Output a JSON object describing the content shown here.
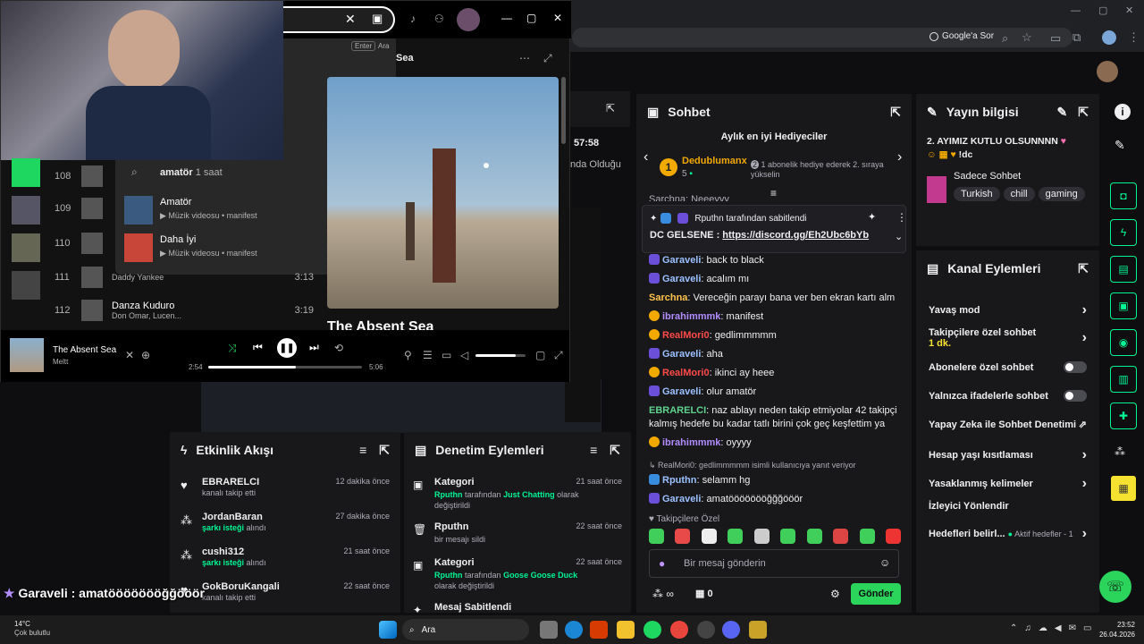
{
  "chrome": {
    "google_ask": "Google'a Sor"
  },
  "spotify": {
    "search_value": "amatör",
    "enter_hint": "Enter",
    "ara_hint": "Ara",
    "suggestion_query": "amatör",
    "suggestion_time": "1 saat",
    "results": [
      {
        "title": "Amatör",
        "meta": "Müzik videosu • manifest"
      },
      {
        "title": "Daha İyi",
        "meta": "Müzik videosu • manifest"
      }
    ],
    "album_title_header": "Sea",
    "album_title": "The Absent Sea",
    "tracks": [
      {
        "num": "108",
        "title": "",
        "artist": "",
        "duration": ""
      },
      {
        "num": "109",
        "title": "",
        "artist": "",
        "duration": ""
      },
      {
        "num": "110",
        "title": "",
        "artist": "",
        "duration": ""
      },
      {
        "num": "111",
        "title": "",
        "artist": "Daddy Yankee",
        "duration": "3:13"
      },
      {
        "num": "112",
        "title": "Danza Kuduro",
        "artist": "Don Omar, Lucen...",
        "duration": "3:19"
      }
    ],
    "now_playing_title": "The Absent Sea",
    "now_playing_artist": "Meltt",
    "elapsed": "2:54",
    "total": "5:06",
    "progress": 0.57,
    "volume": 0.8
  },
  "overlay_text": {
    "time": "57:58",
    "olduğu": "nda Olduğu",
    "garaveli": "Garaveli : amatöööööööğğööör"
  },
  "stream_info": {
    "title": "Yayın bilgisi",
    "stream_title": "2. AYIMIZ KUTLU OLSUNNNN",
    "stream_title2": "!dc",
    "category": "Sadece Sohbet",
    "tags": [
      "Turkish",
      "chill",
      "gaming"
    ]
  },
  "channel_actions": {
    "title": "Kanal Eylemleri",
    "items": [
      {
        "label": "Yavaş mod",
        "control": "chevron"
      },
      {
        "label": "Takipçilere özel sohbet",
        "sub": "1 dk.",
        "control": "chevron"
      },
      {
        "label": "Abonelere özel sohbet",
        "control": "toggle"
      },
      {
        "label": "Yalnızca ifadelerle sohbet",
        "control": "toggle"
      },
      {
        "label": "Yapay Zeka ile Sohbet Denetimi",
        "control": "external"
      },
      {
        "label": "Hesap yaşı kısıtlaması",
        "control": "chevron"
      },
      {
        "label": "Yasaklanmış kelimeler",
        "control": "chevron"
      },
      {
        "label": "İzleyici Yönlendir",
        "control": "none"
      },
      {
        "label": "Hedefleri belirl...",
        "sub2": "Aktif hedefler - 1",
        "control": "chevron"
      }
    ]
  },
  "chat": {
    "title": "Sohbet",
    "top_gifters_title": "Aylık en iyi Hediyeciler",
    "gifter_name": "Dedublumanx",
    "gifter_count": "5",
    "gifter_note": "1 abonelik hediye ederek 2. sıraya yükselin",
    "partial_line": "Sarchna: Neeeyyy",
    "pinned_by": "Rputhn tarafından sabitlendi",
    "pinned_prefix": "DC GELSENE : ",
    "pinned_link": "https://discord.gg/Eh2Ubc6bYb",
    "messages": [
      {
        "user": "Garaveli",
        "color": "#9cc0ff",
        "text": "back to black",
        "badge": "star"
      },
      {
        "user": "Garaveli",
        "color": "#9cc0ff",
        "text": "acalım mı",
        "badge": "star"
      },
      {
        "user": "Sarchna",
        "color": "#ffc34d",
        "text": "Vereceğin parayı bana ver ben ekran kartı alm",
        "badge": ""
      },
      {
        "user": "ibrahimmmk",
        "color": "#b18cff",
        "text": "manifest",
        "badge": "gold"
      },
      {
        "user": "RealMori0",
        "color": "#ff4a4a",
        "text": "gedlimmmmm",
        "badge": "gold"
      },
      {
        "user": "Garaveli",
        "color": "#9cc0ff",
        "text": "aha",
        "badge": "star"
      },
      {
        "user": "RealMori0",
        "color": "#ff4a4a",
        "text": "ikinci ay heee",
        "badge": "gold"
      },
      {
        "user": "Garaveli",
        "color": "#9cc0ff",
        "text": "olur amatör",
        "badge": "star"
      },
      {
        "user": "EBRARELCI",
        "color": "#5fd38d",
        "text": "naz ablayı neden takip etmiyolar 42 takipçi kalmış hedefe bu kadar tatlı birini çok geç keşfettim ya",
        "badge": ""
      },
      {
        "user": "ibrahimmmk",
        "color": "#b18cff",
        "text": "oyyyy",
        "badge": "gold"
      }
    ],
    "reply_to": "RealMori0: gedlimmmmm isimli kullanıcıya yanıt veriyor",
    "reply_messages": [
      {
        "user": "Rputhn",
        "color": "#9cc0ff",
        "text": "selamm hg",
        "badge": "blue"
      },
      {
        "user": "Garaveli",
        "color": "#9cc0ff",
        "text": "amatöööööööğğğööör",
        "badge": "star"
      }
    ],
    "followers_only": "Takipçilere Özel",
    "input_placeholder": "Bir mesaj gönderin",
    "points": "0",
    "send_button": "Gönder"
  },
  "activity": {
    "title": "Etkinlik Akışı",
    "items": [
      {
        "user": "EBRARELCI",
        "action": "kanalı takip etti",
        "time": "12 dakika önce",
        "icon": "heart"
      },
      {
        "user": "JordanBaran",
        "action": "şarkı isteği",
        "action2": "alındı",
        "time": "27 dakika önce",
        "icon": "points"
      },
      {
        "user": "cushi312",
        "action": "şarkı isteği",
        "action2": "alındı",
        "time": "21 saat önce",
        "icon": "points"
      },
      {
        "user": "GokBoruKangali",
        "action": "kanalı takip etti",
        "time": "22 saat önce",
        "icon": "heart"
      }
    ]
  },
  "moderation": {
    "title": "Denetim Eylemleri",
    "items": [
      {
        "head": "Kategori",
        "time": "21 saat önce",
        "actor": "Rputhn",
        "mid": "tarafından",
        "target": "Just Chatting",
        "tail": "olarak değiştirildi"
      },
      {
        "head": "Rputhn",
        "time": "22 saat önce",
        "plain": "bir mesajı sildi"
      },
      {
        "head": "Kategori",
        "time": "22 saat önce",
        "actor": "Rputhn",
        "mid": "tarafından",
        "target": "Goose Goose Duck",
        "tail": "olarak değiştirildi"
      },
      {
        "head": "Mesaj Sabitlendi",
        "time": "",
        "plain": ""
      }
    ]
  },
  "taskbar": {
    "weather_temp": "14°C",
    "weather_desc": "Çok bulutlu",
    "search": "Ara",
    "time": "23:52",
    "date": "26.04.2026"
  }
}
